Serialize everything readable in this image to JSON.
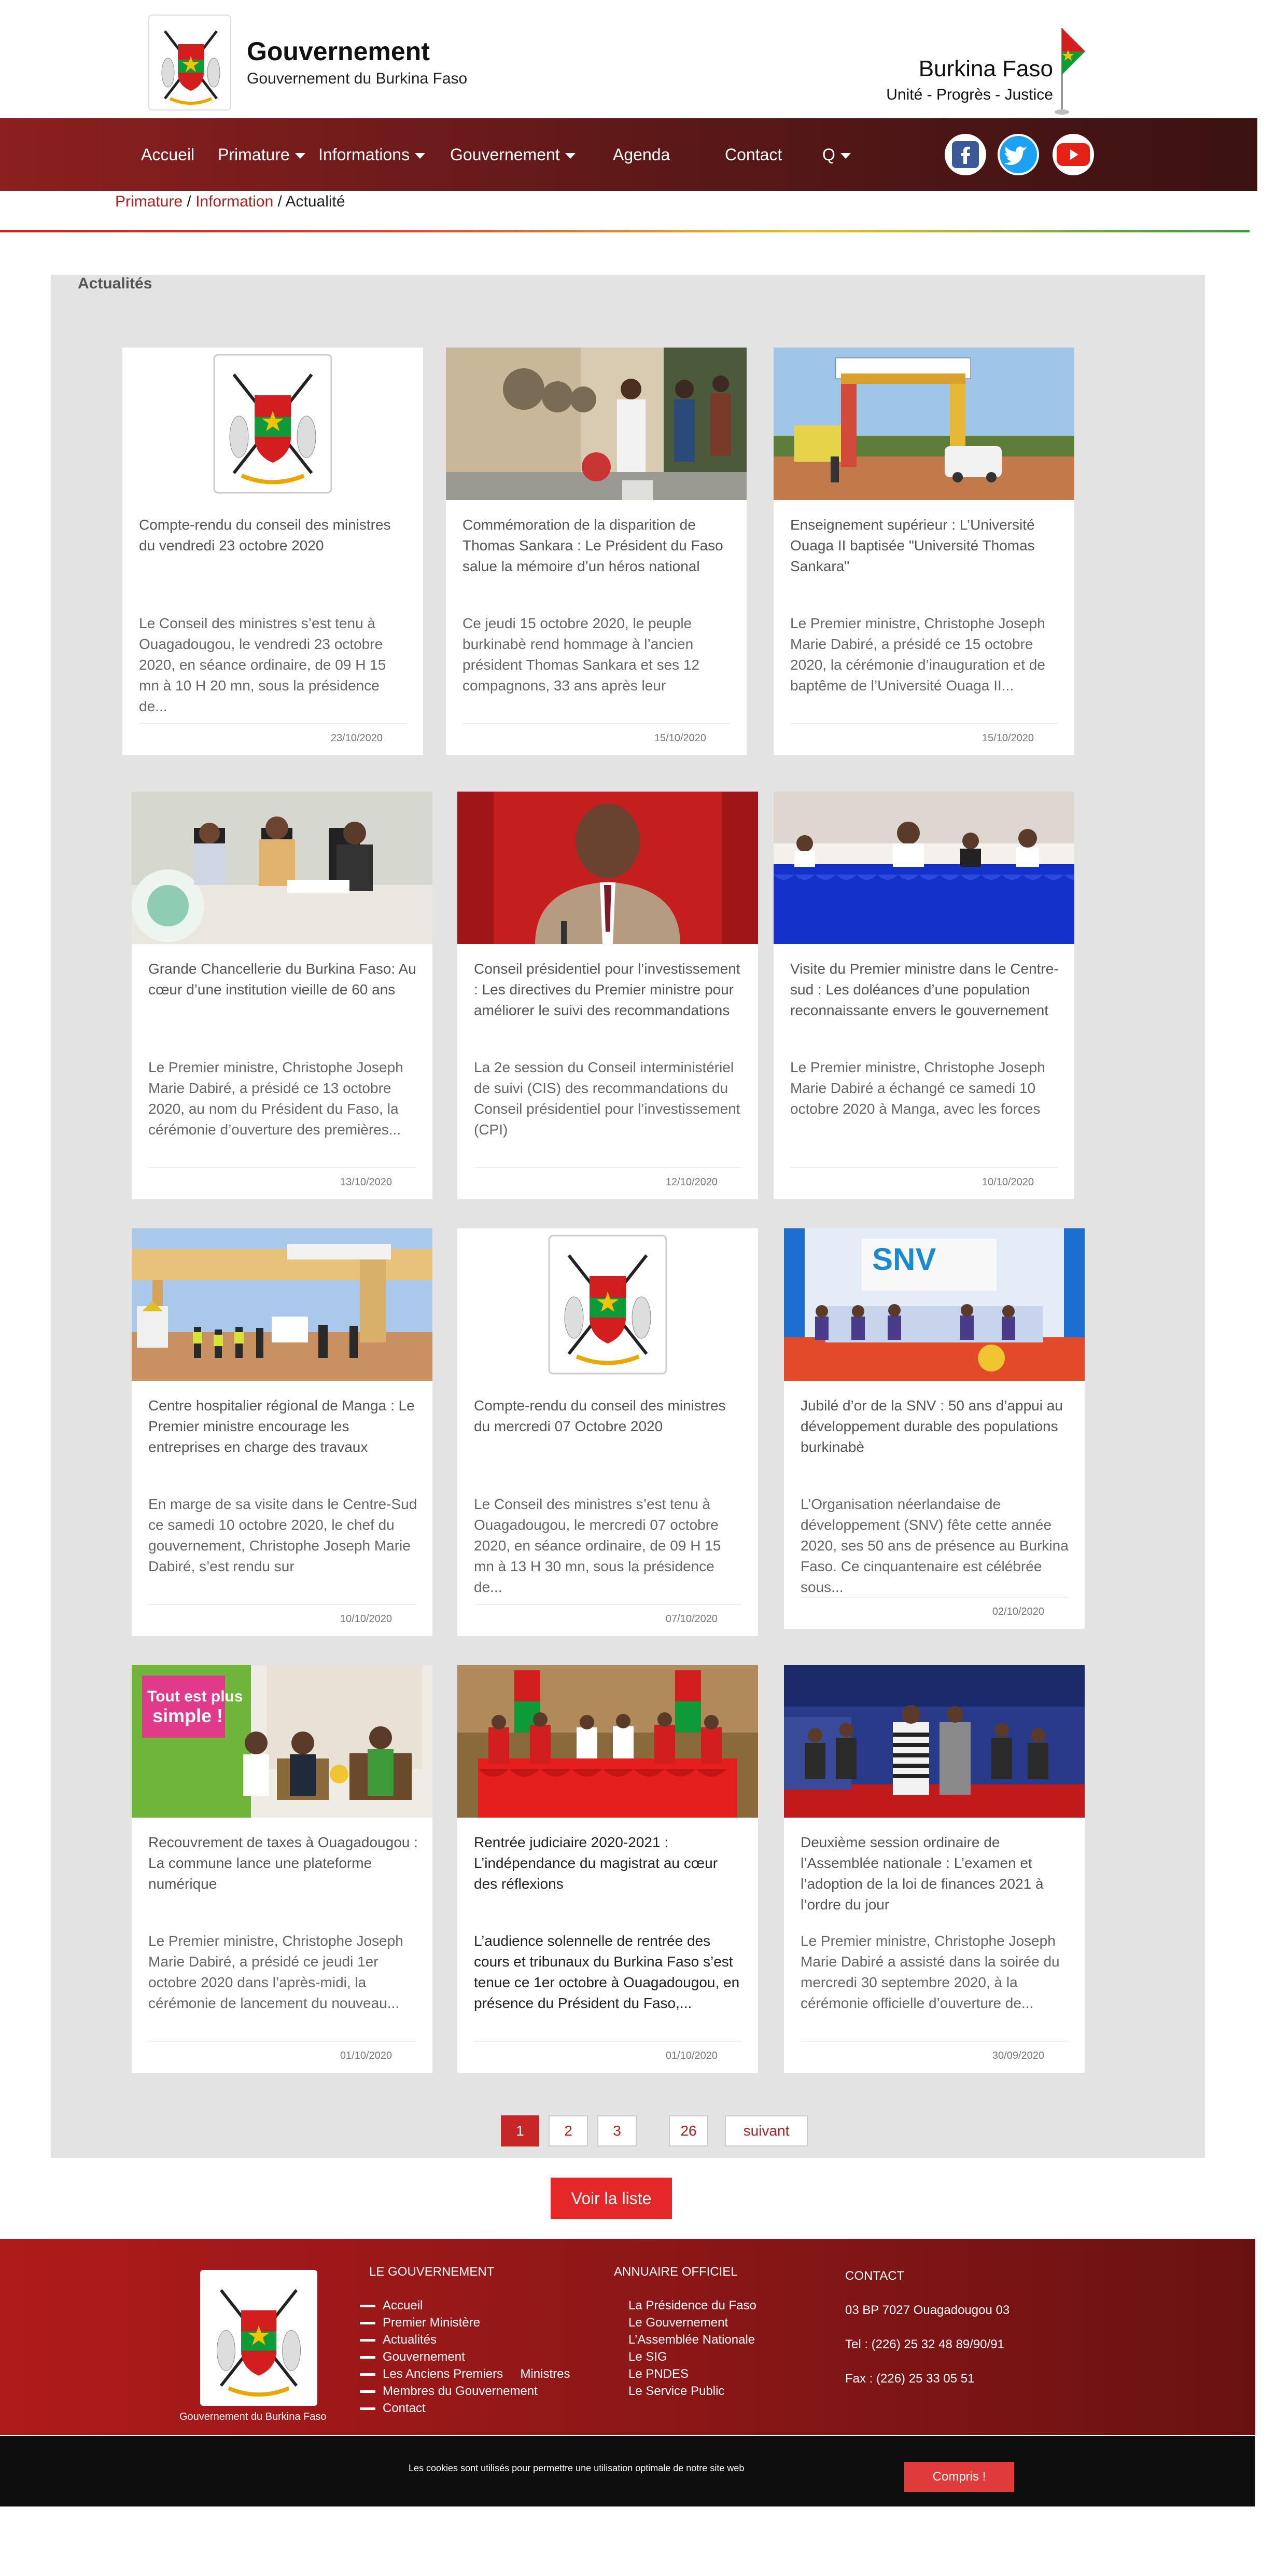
{
  "header": {
    "title": "Gouvernement",
    "subtitle": "Gouvernement du Burkina Faso",
    "country": "Burkina Faso",
    "motto": "Unité - Progrès - Justice"
  },
  "nav": {
    "items": [
      "Accueil",
      "Primature",
      "Informations",
      "Gouvernement",
      "Agenda",
      "Contact",
      "Q"
    ],
    "social": [
      "facebook-icon",
      "twitter-icon",
      "youtube-icon"
    ]
  },
  "breadcrumb": {
    "primature": "Primature",
    "sep1": " / ",
    "information": "Information",
    "sep2": " / ",
    "current": "Actualité"
  },
  "section_title": "Actualités",
  "cards": [
    {
      "title": "Compte-rendu du conseil des ministres du vendredi 23 octobre 2020",
      "excerpt": "Le Conseil des ministres s’est tenu à Ouagadougou, le vendredi 23 octobre 2020, en séance ordinaire, de 09 H 15 mn à 10 H 20 mn, sous la présidence de...",
      "date": "23/10/2020"
    },
    {
      "title": "Commémoration de la disparition de Thomas Sankara : Le Président du Faso salue la mémoire d’un héros national",
      "excerpt": "Ce jeudi 15 octobre 2020, le peuple burkinabè rend hommage à l’ancien président Thomas Sankara et ses 12 compagnons, 33 ans après leur",
      "date": "15/10/2020"
    },
    {
      "title": "Enseignement supérieur : L’Université Ouaga II baptisée \"Université Thomas Sankara\"",
      "excerpt": "Le Premier ministre, Christophe Joseph Marie Dabiré, a présidé ce 15 octobre 2020, la cérémonie d’inauguration et de baptême de l’Université Ouaga II...",
      "date": "15/10/2020"
    },
    {
      "title": "Grande Chancellerie du Burkina Faso: Au cœur d’une institution vieille de 60 ans",
      "excerpt": "Le Premier ministre, Christophe Joseph Marie Dabiré, a présidé ce 13 octobre 2020, au nom du Président du Faso, la cérémonie d’ouverture des premières...",
      "date": "13/10/2020"
    },
    {
      "title": "Conseil présidentiel pour l’investissement : Les directives du Premier ministre pour améliorer le suivi des recommandations",
      "excerpt": "La 2e session du Conseil interministériel de suivi (CIS) des recommandations du Conseil présidentiel pour l’investissement (CPI)",
      "date": "12/10/2020"
    },
    {
      "title": "Visite du Premier ministre dans le Centre-sud : Les doléances d’une population reconnaissante envers le gouvernement",
      "excerpt": "Le Premier ministre, Christophe Joseph Marie Dabiré a échangé ce samedi 10 octobre 2020 à Manga, avec les forces",
      "date": "10/10/2020"
    },
    {
      "title": "Centre hospitalier régional de Manga : Le Premier ministre encourage les entreprises en charge des travaux",
      "excerpt": "En marge de sa visite dans le Centre-Sud ce samedi 10 octobre 2020, le chef du gouvernement, Christophe Joseph Marie Dabiré, s’est rendu sur",
      "date": "10/10/2020"
    },
    {
      "title": "Compte-rendu du conseil des ministres du mercredi 07 Octobre 2020",
      "excerpt": "Le Conseil des ministres s’est tenu à Ouagadougou, le mercredi 07 octobre 2020, en séance ordinaire, de 09 H 15 mn à 13 H 30 mn, sous la présidence de...",
      "date": "07/10/2020"
    },
    {
      "title": "Jubilé d’or de la SNV : 50 ans d’appui au développement durable des populations burkinabè",
      "excerpt": "L’Organisation néerlandaise de développement (SNV) fête cette année 2020, ses 50 ans de présence au Burkina Faso. Ce cinquantenaire est célébrée sous...",
      "date": "02/10/2020"
    },
    {
      "title": "Recouvrement de taxes à Ouagadougou : La commune lance une plateforme numérique",
      "excerpt": "Le Premier ministre, Christophe Joseph Marie Dabiré, a présidé ce jeudi 1er octobre 2020 dans l’après-midi, la cérémonie de lancement du nouveau...",
      "date": "01/10/2020"
    },
    {
      "title": "Rentrée judiciaire 2020-2021 : L’indépendance du magistrat au cœur des réflexions",
      "excerpt": "L’audience solennelle de rentrée des cours et tribunaux du Burkina Faso s’est tenue ce 1er octobre à Ouagadougou, en présence du Président du Faso,...",
      "date": "01/10/2020"
    },
    {
      "title": "Deuxième session ordinaire de l’Assemblée nationale : L’examen et l’adoption de la loi de finances 2021 à l’ordre du jour",
      "excerpt": "Le Premier ministre, Christophe Joseph Marie Dabiré a assisté dans la soirée du mercredi 30 septembre 2020, à la cérémonie officielle d’ouverture de...",
      "date": "30/09/2020"
    }
  ],
  "pagination": {
    "pages": [
      "1",
      "2",
      "3",
      "26"
    ],
    "next": "suivant",
    "current": "1"
  },
  "list_button": "Voir la liste",
  "footer": {
    "logo_caption": "Gouvernement du Burkina Faso",
    "gov_heading": "LE GOUVERNEMENT",
    "gov_links": [
      "Accueil",
      "Premier Ministère",
      "Actualités",
      "Gouvernement",
      "Les Anciens Premiers     Ministres",
      "Membres du Gouvernement",
      "Contact"
    ],
    "annuaire_heading": "ANNUAIRE OFFICIEL",
    "annuaire_links": [
      "La Présidence du Faso",
      "Le Gouvernement",
      "L’Assemblée Nationale",
      "Le SIG",
      "Le PNDES",
      "Le Service Public"
    ],
    "contact_heading": "CONTACT",
    "address": "03 BP 7027 Ouagadougou 03",
    "tel": "Tel : (226) 25 32 48 89/90/91",
    "fax": "Fax : (226) 25 33 05 51"
  },
  "cookie": {
    "text": "Les cookies sont utilisés pour permettre une utilisation optimale de notre site web",
    "button": "Compris !"
  },
  "colors": {
    "nav_bg": "#5a1818",
    "accent": "#c62626",
    "footer_bg": "#8e1717",
    "panel_bg": "#e3e3e3"
  }
}
